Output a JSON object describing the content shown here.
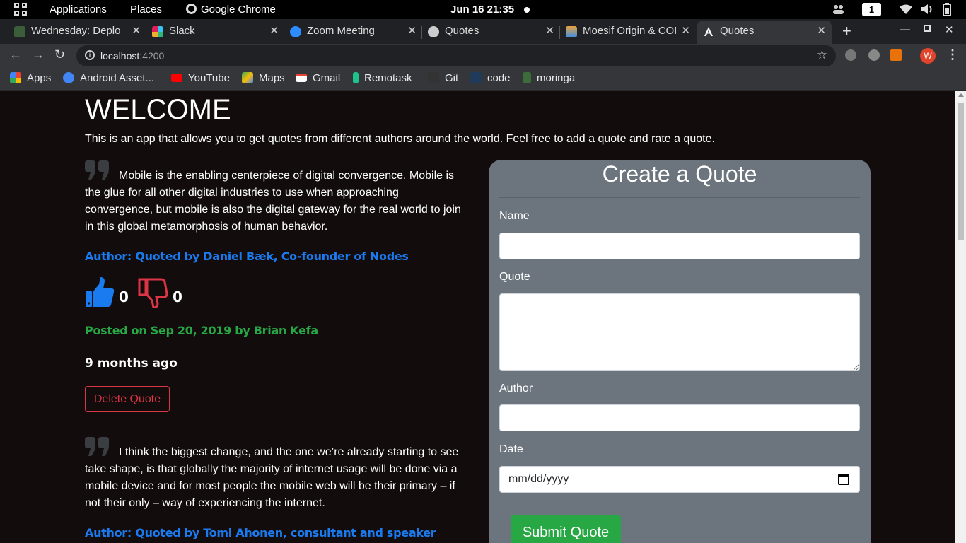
{
  "topbar": {
    "applications": "Applications",
    "places": "Places",
    "active_app": "Google Chrome",
    "clock": "Jun 16  21:35",
    "workspace": "1"
  },
  "tabs": [
    {
      "title": "Wednesday: Deplo",
      "favicon_color": "#3b5d3a"
    },
    {
      "title": "Slack",
      "favicon_color": "#e01e5a"
    },
    {
      "title": "Zoom Meeting",
      "favicon_color": "#2d8cff"
    },
    {
      "title": "Quotes",
      "favicon_color": "#cccccc"
    },
    {
      "title": "Moesif Origin & COR",
      "favicon_color": "#e8a33d"
    },
    {
      "title": "Quotes",
      "favicon_color": "#dd0031",
      "active": true
    }
  ],
  "address": {
    "host": "localhost",
    "port": ":4200"
  },
  "bookmarks": [
    {
      "label": "Apps",
      "icon": "apps-grid-icon",
      "color": "#ea4335"
    },
    {
      "label": "Android Asset...",
      "icon": "android-asset-icon",
      "color": "#4285f4"
    },
    {
      "label": "YouTube",
      "icon": "youtube-icon",
      "color": "#ff0000"
    },
    {
      "label": "Maps",
      "icon": "maps-icon",
      "color": "#34a853"
    },
    {
      "label": "Gmail",
      "icon": "gmail-icon",
      "color": "#ea4335"
    },
    {
      "label": "Remotask",
      "icon": "remotask-icon",
      "color": "#1ec28b"
    },
    {
      "label": "Git",
      "icon": "git-icon",
      "color": "#333333"
    },
    {
      "label": "code",
      "icon": "code-icon",
      "color": "#1f3a5a"
    },
    {
      "label": "moringa",
      "icon": "moringa-icon",
      "color": "#3c6b3c"
    }
  ],
  "page": {
    "heading": "WELCOME",
    "intro": "This is an app that allows you to get quotes from different authors around the world. Feel free to add a quote and rate a quote.",
    "quotes": [
      {
        "text": "Mobile is the enabling centerpiece of digital convergence. Mobile is the glue for all other digital industries to use when approaching convergence, but mobile is also the digital gateway for the real world to join in this global metamorphosis of human behavior.",
        "author": "Author: Quoted by  Daniel Bæk, Co-founder of Nodes",
        "upvotes": "0",
        "downvotes": "0",
        "posted": "Posted on Sep 20, 2019 by Brian Kefa",
        "ago": "9 months ago",
        "delete_label": "Delete Quote"
      },
      {
        "text": "I think the biggest change, and the one we’re already starting to see take shape, is that globally the majority of internet usage will be done via a mobile device and for most people the mobile web will be their primary – if not their only – way of experiencing the internet.",
        "author": "Author: Quoted by Tomi Ahonen, consultant and speaker"
      }
    ]
  },
  "form": {
    "title": "Create a Quote",
    "name_label": "Name",
    "name_value": "",
    "quote_label": "Quote",
    "quote_value": "",
    "author_label": "Author",
    "author_value": "",
    "date_label": "Date",
    "date_placeholder": "mm/dd/yyyy",
    "submit_label": "Submit Quote"
  },
  "colors": {
    "page_bg": "#120c0c",
    "author_blue": "#1a7bf0",
    "posted_green": "#28a745",
    "delete_red": "#dc3545",
    "panel_gray": "#6c757d"
  }
}
